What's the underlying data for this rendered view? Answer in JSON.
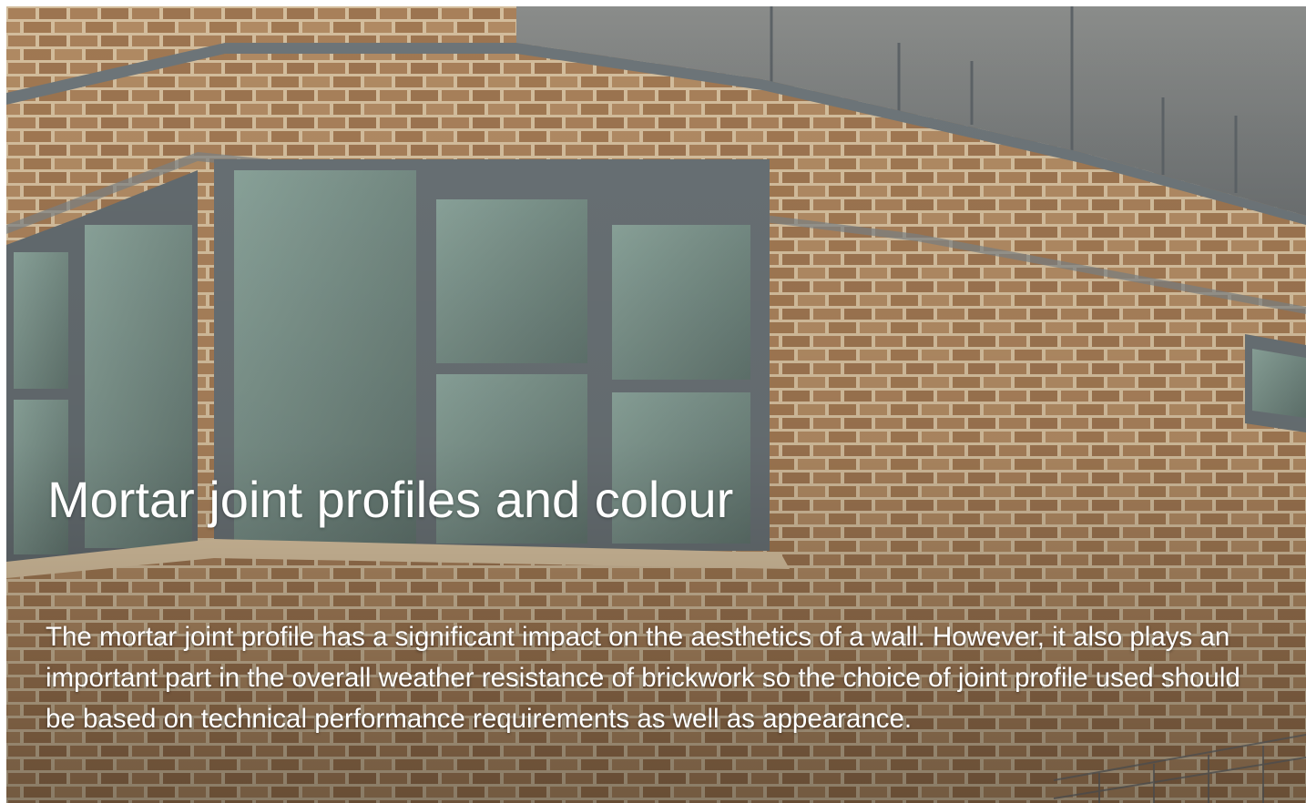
{
  "hero": {
    "title": "Mortar joint profiles and colour",
    "body": "The mortar joint profile has a significant impact on the aesthetics of a wall. However, it also plays an important part in the overall weather resistance of brickwork so the choice of joint profile used should be based on technical performance requirements as well as appearance."
  },
  "colors": {
    "brick": "#a47d58",
    "mortar": "#d2bc9c",
    "window_frame": "#6f767a",
    "glass": "#7b8e86",
    "text": "#ffffff"
  }
}
